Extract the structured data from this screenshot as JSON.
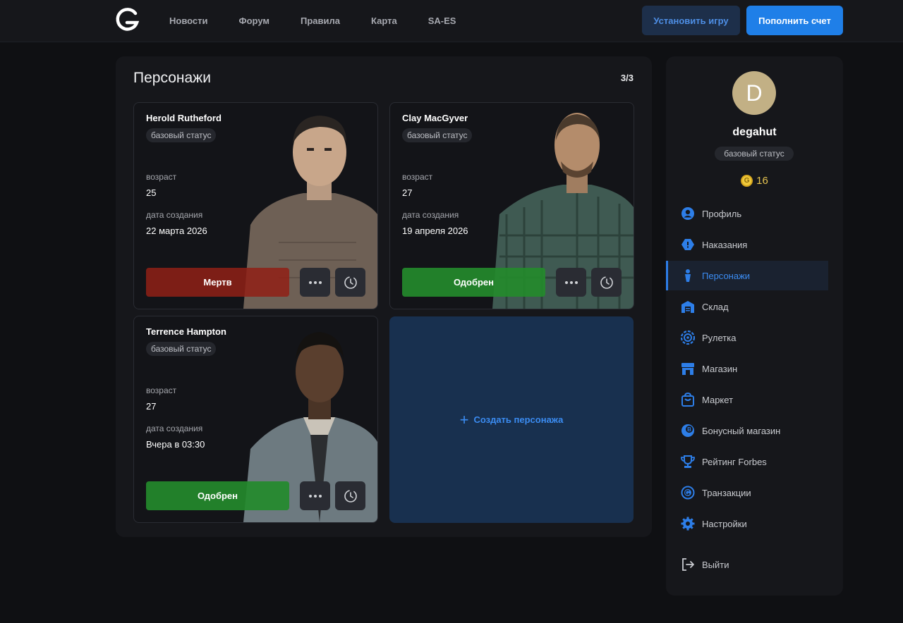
{
  "header": {
    "nav": [
      "Новости",
      "Форум",
      "Правила",
      "Карта",
      "SA-ES"
    ],
    "install_label": "Установить игру",
    "topup_label": "Пополнить счет"
  },
  "main": {
    "title": "Персонажи",
    "count": "3/3",
    "labels": {
      "age": "возраст",
      "created": "дата создания"
    },
    "characters": [
      {
        "name": "Herold Rutheford",
        "status": "базовый статус",
        "age": "25",
        "created": "22 марта 2026",
        "state": "Мертв"
      },
      {
        "name": "Clay MacGyver",
        "status": "базовый статус",
        "age": "27",
        "created": "19 апреля 2026",
        "state": "Одобрен"
      },
      {
        "name": "Terrence Hampton",
        "status": "базовый статус",
        "age": "27",
        "created": "Вчера в 03:30",
        "state": "Одобрен"
      }
    ],
    "create_label": "Создать персонажа"
  },
  "sidebar": {
    "avatar_letter": "D",
    "username": "degahut",
    "status": "базовый статус",
    "coins": "16",
    "coin_symbol": "G",
    "menu": [
      {
        "label": "Профиль",
        "icon": "user-icon"
      },
      {
        "label": "Наказания",
        "icon": "warning-icon"
      },
      {
        "label": "Персонажи",
        "icon": "person-icon",
        "active": true
      },
      {
        "label": "Склад",
        "icon": "warehouse-icon"
      },
      {
        "label": "Рулетка",
        "icon": "roulette-icon"
      },
      {
        "label": "Магазин",
        "icon": "shop-icon"
      },
      {
        "label": "Маркет",
        "icon": "bag-icon"
      },
      {
        "label": "Бонусный магазин",
        "icon": "bonus-icon"
      },
      {
        "label": "Рейтинг Forbes",
        "icon": "trophy-icon"
      },
      {
        "label": "Транзакции",
        "icon": "transactions-icon"
      },
      {
        "label": "Настройки",
        "icon": "settings-icon"
      }
    ],
    "logout_label": "Выйти"
  },
  "colors": {
    "accent": "#1f7fe8",
    "approved": "#248a2c",
    "dead": "#912016",
    "create_bg": "#18304f"
  }
}
